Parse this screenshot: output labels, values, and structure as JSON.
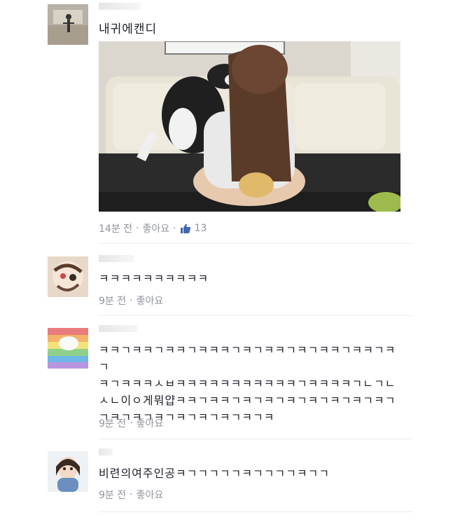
{
  "comments": [
    {
      "text": "내귀에캔디",
      "time": "14분 전",
      "like_label": "좋아요",
      "like_count": "13"
    },
    {
      "text": "ㅋㅋㅋㅋㅋㅋㅋㅋㅋㅋ",
      "time": "9분 전",
      "like_label": "좋아요"
    },
    {
      "text": "ㅋㅋㄱㅋㅋㄱㅋㅋㄱㅋㅋㅋㄱㅋㄱㅋㅋㄱㅋㄱㅋㅋㄱㅋㅋㄱㅋㄱ\nㅋㄱㅋㅋㅋㅅㅂㅋㅋㅋㅋㅋㅋㅋㅋㅋㅋㅋㄱㅋㅋㅋㅋㄱㄴㄱㄴ\nㅅㄴ이ㅇ게뭐얍ㅋㅋㄱㅋㅋㄱㅋㄱㅋㄱㅋㄱㅋㄱㅋㄱㅋㄱㅋㄱ\nㄱㅋㄱㅋㄱㅋㄱㅋㄱㅋㄱㅋㄱㅋㄱㅋ",
      "time": "9분 전",
      "like_label": "좋아요"
    },
    {
      "text": "비련의여주인공ㅋㄱㄱㄱㄱㄱㅋㄱㄱㄱㄱㅋㄱㄱ",
      "time": "9분 전",
      "like_label": "좋아요"
    }
  ],
  "separator": "·"
}
